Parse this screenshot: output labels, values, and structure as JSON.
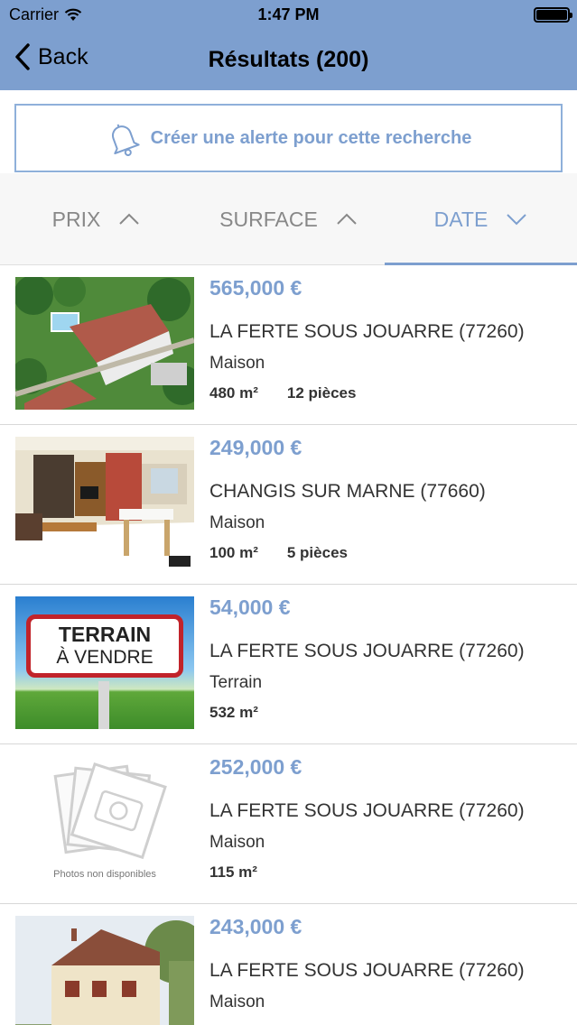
{
  "status": {
    "carrier": "Carrier",
    "time": "1:47 PM"
  },
  "nav": {
    "back_label": "Back",
    "title": "Résultats (200)"
  },
  "alert": {
    "label": "Créer une alerte pour cette recherche",
    "icon": "bell-icon"
  },
  "sort": {
    "tabs": [
      {
        "label": "PRIX",
        "direction": "up",
        "active": false
      },
      {
        "label": "SURFACE",
        "direction": "up",
        "active": false
      },
      {
        "label": "DATE",
        "direction": "down",
        "active": true
      }
    ]
  },
  "results": [
    {
      "price": "565,000 €",
      "city": "LA FERTE SOUS JOUARRE (77260)",
      "type": "Maison",
      "surface": "480 m²",
      "rooms": "12 pièces",
      "photo": "aerial-house-photo"
    },
    {
      "price": "249,000 €",
      "city": "CHANGIS SUR MARNE (77660)",
      "type": "Maison",
      "surface": "100 m²",
      "rooms": "5 pièces",
      "photo": "living-room-photo"
    },
    {
      "price": "54,000 €",
      "city": "LA FERTE SOUS JOUARRE (77260)",
      "type": "Terrain",
      "surface": "532 m²",
      "rooms": "",
      "photo": "terrain-sign-photo",
      "sign_line1": "TERRAIN",
      "sign_line2": "À VENDRE"
    },
    {
      "price": "252,000 €",
      "city": "LA FERTE SOUS JOUARRE (77260)",
      "type": "Maison",
      "surface": "115 m²",
      "rooms": "",
      "photo": "no-photo-placeholder",
      "placeholder_text": "Photos non disponibles"
    },
    {
      "price": "243,000 €",
      "city": "LA FERTE SOUS JOUARRE (77260)",
      "type": "Maison",
      "surface": "",
      "rooms": "",
      "photo": "house-exterior-photo"
    }
  ],
  "colors": {
    "accent": "#7d9fcf",
    "nav_bg": "#7d9fcf",
    "sort_bg": "#f7f7f7"
  }
}
